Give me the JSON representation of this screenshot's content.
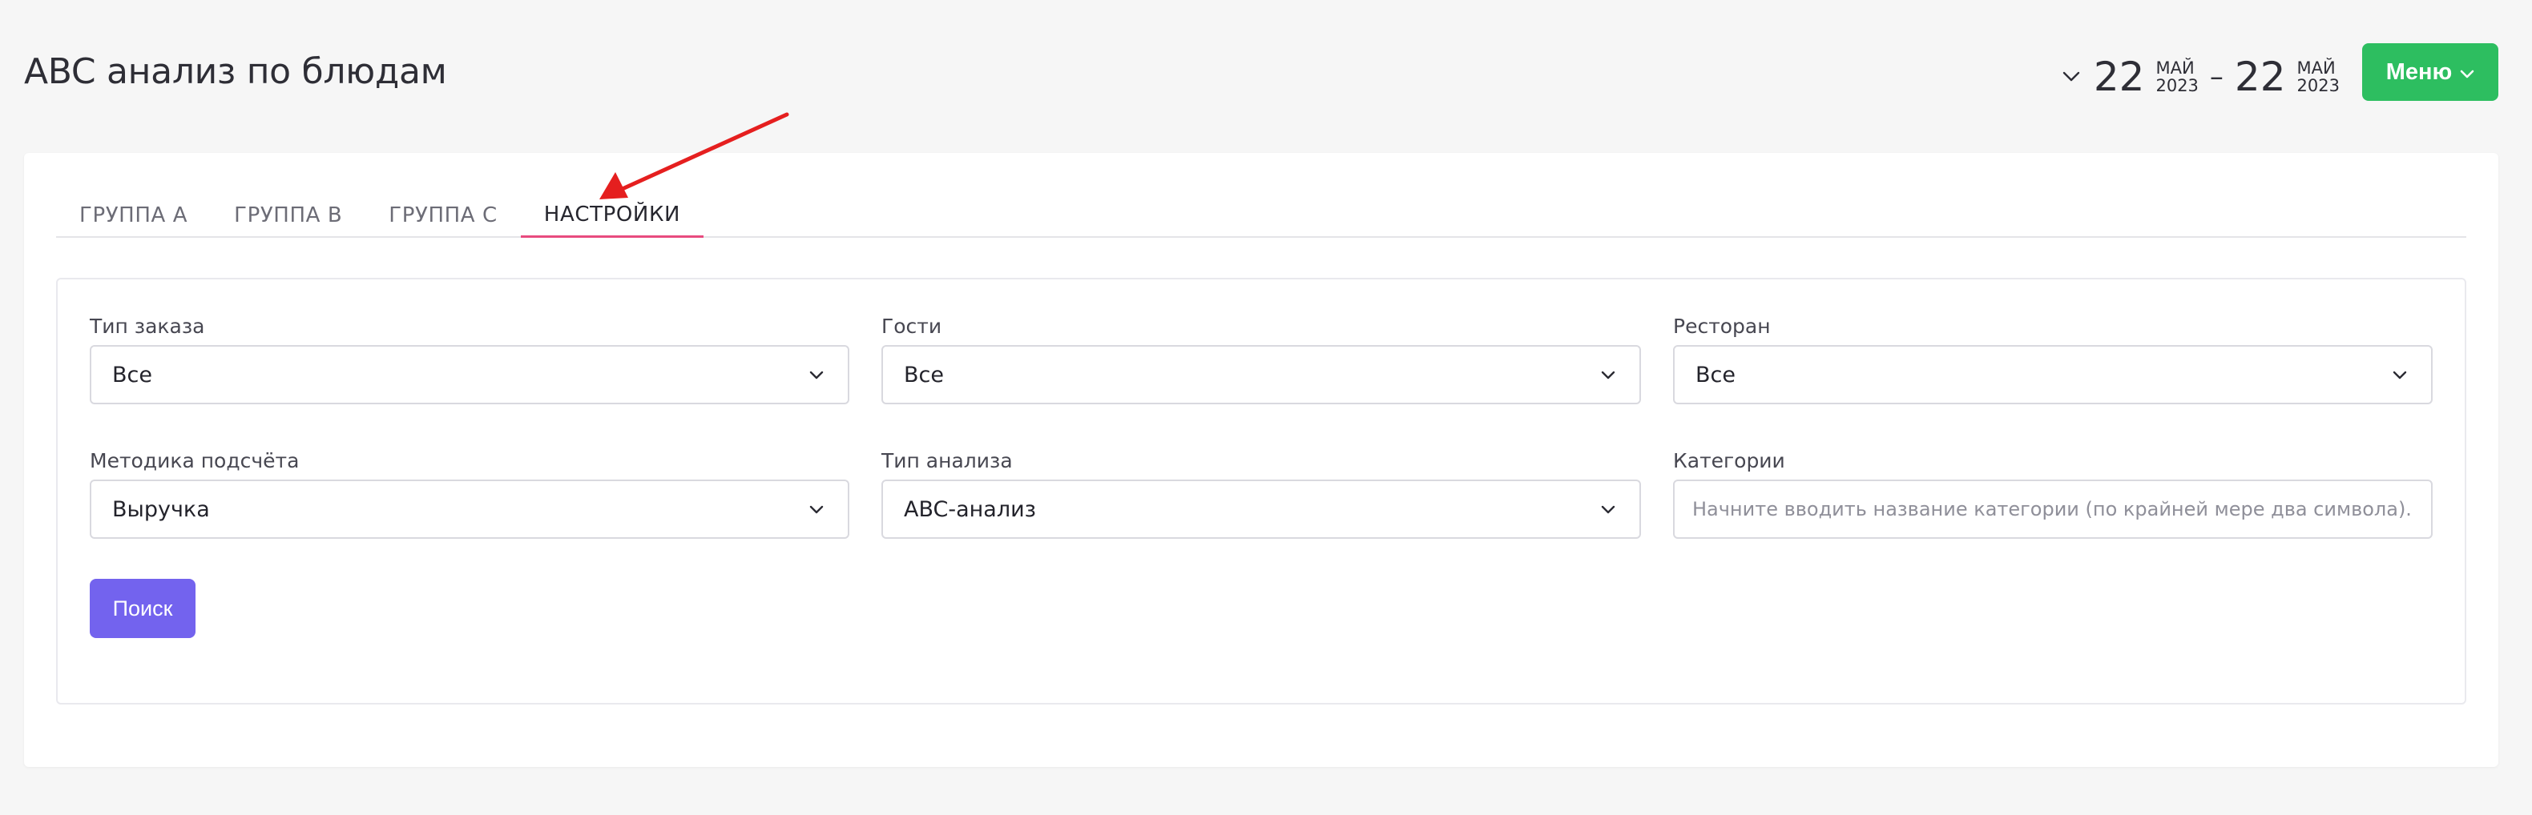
{
  "header": {
    "title": "ABC анализ по блюдам",
    "date_from": {
      "day": "22",
      "month": "МАЙ",
      "year": "2023"
    },
    "date_separator": "–",
    "date_to": {
      "day": "22",
      "month": "МАЙ",
      "year": "2023"
    },
    "menu_label": "Меню"
  },
  "tabs": [
    {
      "label": "ГРУППА A",
      "active": false
    },
    {
      "label": "ГРУППА B",
      "active": false
    },
    {
      "label": "ГРУППА C",
      "active": false
    },
    {
      "label": "НАСТРОЙКИ",
      "active": true
    }
  ],
  "settings": {
    "order_type": {
      "label": "Тип заказа",
      "value": "Все"
    },
    "guests": {
      "label": "Гости",
      "value": "Все"
    },
    "restaurant": {
      "label": "Ресторан",
      "value": "Все"
    },
    "calc_method": {
      "label": "Методика подсчёта",
      "value": "Выручка"
    },
    "analysis_type": {
      "label": "Тип анализа",
      "value": "ABC-анализ"
    },
    "categories": {
      "label": "Категории",
      "placeholder": "Начните вводить название категории (по крайней мере два символа)..."
    },
    "search_label": "Поиск"
  },
  "colors": {
    "menu_button": "#2dbe60",
    "active_tab_underline": "#e84b7f",
    "search_button": "#7363ee",
    "annotation_arrow": "#e51f1f"
  },
  "icons": {
    "date_picker": "chevron-down-icon",
    "menu": "chevron-down-icon",
    "select": "chevron-down-icon",
    "annotation": "red-arrow"
  }
}
